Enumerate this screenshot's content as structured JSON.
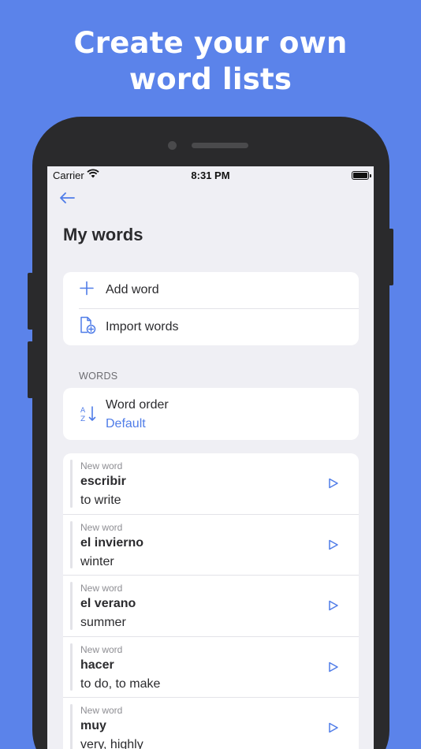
{
  "promo": {
    "headline_line1": "Create your own",
    "headline_line2": "word lists"
  },
  "status_bar": {
    "carrier": "Carrier",
    "time": "8:31 PM"
  },
  "nav": {
    "back_icon": "arrow-left-icon"
  },
  "page": {
    "title": "My words"
  },
  "actions": [
    {
      "label": "Add word",
      "icon": "plus-icon"
    },
    {
      "label": "Import words",
      "icon": "file-add-icon"
    }
  ],
  "words_section": {
    "label": "WORDS",
    "order_label": "Word order",
    "order_value": "Default",
    "order_icon": "sort-az-icon"
  },
  "words": [
    {
      "tag": "New word",
      "term": "escribir",
      "translation": "to write"
    },
    {
      "tag": "New word",
      "term": "el invierno",
      "translation": "winter"
    },
    {
      "tag": "New word",
      "term": "el verano",
      "translation": "summer"
    },
    {
      "tag": "New word",
      "term": "hacer",
      "translation": "to do, to make"
    },
    {
      "tag": "New word",
      "term": "muy",
      "translation": "very, highly"
    }
  ],
  "colors": {
    "background": "#5b83ea",
    "accent": "#4f7ce8",
    "phone_frame": "#2a2a2c",
    "screen_bg": "#efeff4"
  }
}
